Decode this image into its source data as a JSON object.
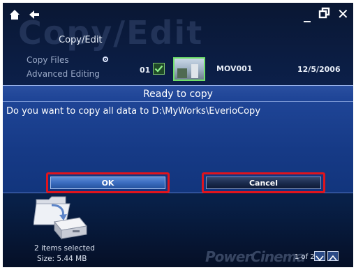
{
  "app": {
    "watermark_text": "Copy/Edit",
    "brand_text": "PowerCinema"
  },
  "topbar": {
    "minimize_glyph": "_",
    "close_glyph": "✕"
  },
  "sidebar": {
    "title": "Copy/Edit",
    "items": [
      {
        "label": "Copy Files",
        "selected": true
      },
      {
        "label": "Advanced Editing",
        "selected": false
      }
    ]
  },
  "file_row": {
    "index": "01",
    "checked": true,
    "name": "MOV001",
    "date": "12/5/2006"
  },
  "dialog": {
    "title": "Ready to copy",
    "message": "Do you want to copy all data to D:\\MyWorks\\EverioCopy",
    "ok_label": "OK",
    "cancel_label": "Cancel"
  },
  "status": {
    "items_selected": "2 items selected",
    "size": "Size: 5.44 MB"
  },
  "pager": {
    "text": "1 of 2"
  },
  "colors": {
    "highlight": "#e0141d",
    "dialog_bg": "#1f4597",
    "check_green": "#7fc56f"
  }
}
